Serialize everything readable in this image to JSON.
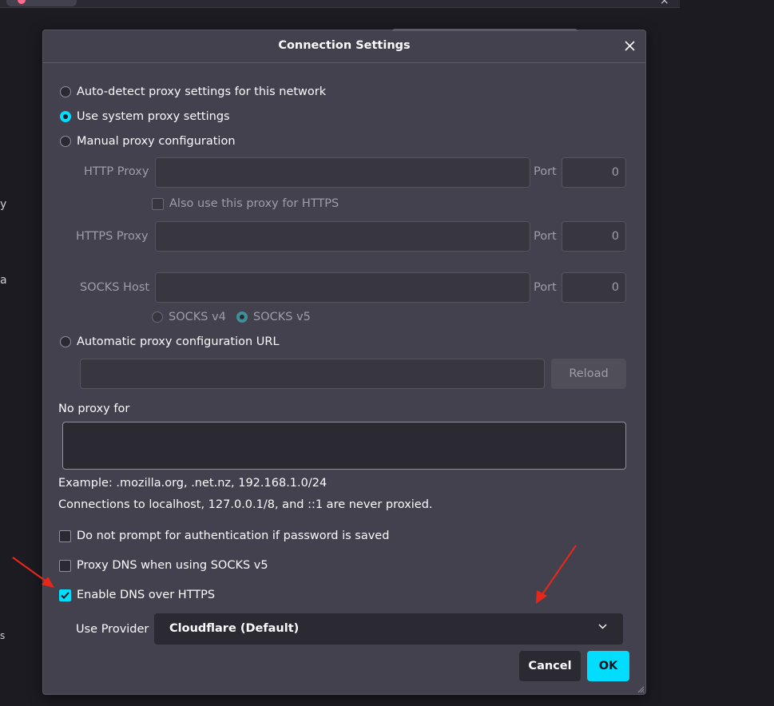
{
  "dialog": {
    "title": "Connection Settings",
    "proxy_modes": [
      {
        "label": "Auto-detect proxy settings for this network",
        "checked": false
      },
      {
        "label": "Use system proxy settings",
        "checked": true
      },
      {
        "label": "Manual proxy configuration",
        "checked": false
      }
    ],
    "http_proxy": {
      "label": "HTTP Proxy",
      "value": "",
      "port_label": "Port",
      "port_value": "0"
    },
    "also_https_label": "Also use this proxy for HTTPS",
    "https_proxy": {
      "label": "HTTPS Proxy",
      "value": "",
      "port_label": "Port",
      "port_value": "0"
    },
    "socks_host": {
      "label": "SOCKS Host",
      "value": "",
      "port_label": "Port",
      "port_value": "0"
    },
    "socks_versions": [
      {
        "label": "SOCKS v4",
        "checked": false
      },
      {
        "label": "SOCKS v5",
        "checked": true
      }
    ],
    "auto_config": {
      "label": "Automatic proxy configuration URL",
      "value": "",
      "reload_label": "Reload"
    },
    "no_proxy": {
      "label": "No proxy for",
      "value": ""
    },
    "example_text": "Example: .mozilla.org, .net.nz, 192.168.1.0/24",
    "localhost_note": "Connections to localhost, 127.0.0.1/8, and ::1 are never proxied.",
    "options": [
      {
        "label": "Do not prompt for authentication if password is saved",
        "checked": false
      },
      {
        "label": "Proxy DNS when using SOCKS v5",
        "checked": false
      },
      {
        "label": "Enable DNS over HTTPS",
        "checked": true
      }
    ],
    "provider": {
      "label": "Use Provider",
      "value": "Cloudflare (Default)"
    },
    "cancel_label": "Cancel",
    "ok_label": "OK"
  },
  "background": {
    "fragments": [
      "y",
      "a",
      "s"
    ]
  },
  "colors": {
    "accent": "#00ddff",
    "dialog_bg": "#42414d",
    "page_bg": "#1c1b22",
    "arrow": "#e8271b"
  },
  "icons": [
    "close-icon",
    "chevron-down-icon",
    "checkmark-icon",
    "resize-grip-icon",
    "annotation-arrow-icon"
  ]
}
